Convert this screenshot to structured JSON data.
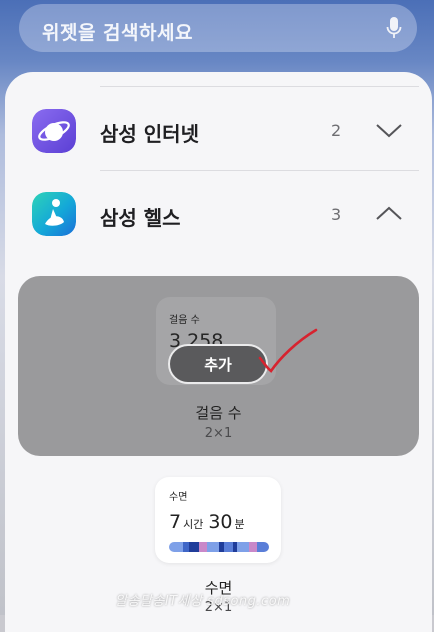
{
  "search": {
    "placeholder": "위젯을 검색하세요",
    "icon": "mic-icon"
  },
  "apps": [
    {
      "name": "삼성 인터넷",
      "count": "2",
      "expanded": false,
      "icon": "samsung-internet-icon"
    },
    {
      "name": "삼성 헬스",
      "count": "3",
      "expanded": true,
      "icon": "samsung-health-icon"
    }
  ],
  "widgets": [
    {
      "preview_label": "걸음 수",
      "preview_value": "3,258",
      "add_label": "추가",
      "name": "걸음 수",
      "size": "2×1",
      "selected": true
    },
    {
      "preview_label": "수면",
      "hours": "7",
      "hours_unit": "시간",
      "minutes": "30",
      "minutes_unit": "분",
      "name": "수면",
      "size": "2×1"
    }
  ],
  "watermark": "알송달송IT세상 sdsong.com",
  "colors": {
    "accent_red": "#d7232f",
    "health_green": "#2f6b3d",
    "sleep_bar": [
      "#7ea0e8",
      "#3f66c7",
      "#203d9a",
      "#c988c9",
      "#5a7ed8"
    ]
  }
}
